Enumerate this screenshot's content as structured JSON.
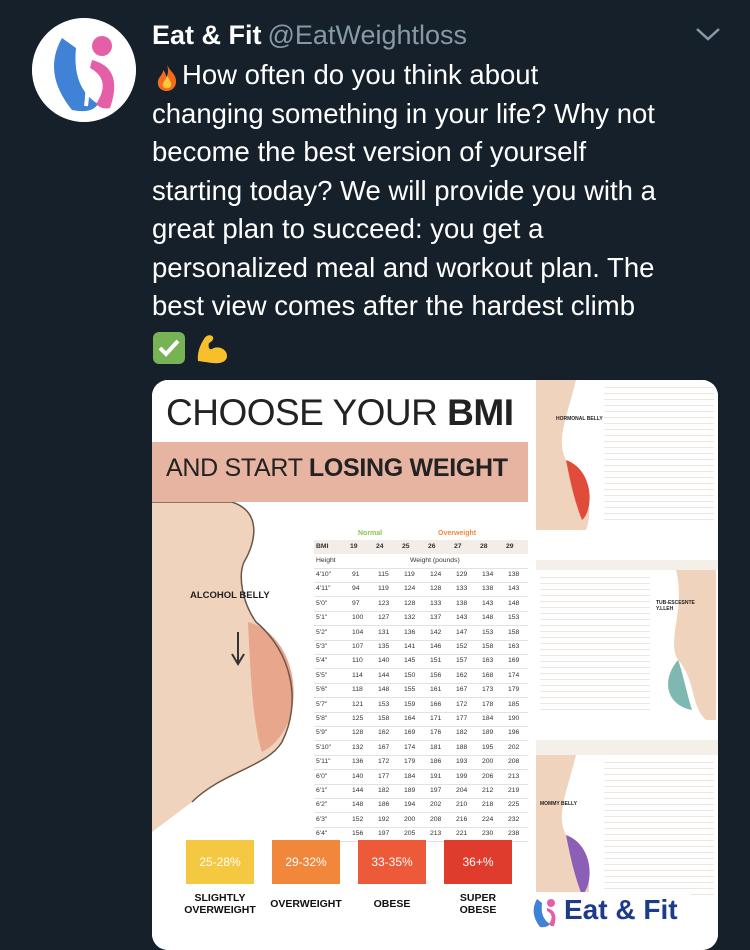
{
  "author": {
    "name": "Eat & Fit",
    "handle": "@EatWeightloss"
  },
  "tweet": {
    "lines": [
      "How often do you think about",
      "changing something in your life? Why not",
      "become the best version of yourself",
      "starting today? We will provide you with a",
      "great plan to succeed: you get a",
      "personalized meal and workout plan. The",
      "best view comes after the hardest climb"
    ]
  },
  "image": {
    "title_prefix": "CHOOSE YOUR ",
    "title_bold": "BMI",
    "subtitle_prefix": "AND START ",
    "subtitle_bold": "LOSING WEIGHT",
    "belly_label": "ALCOHOL BELLY",
    "table": {
      "normal_label": "Normal",
      "overweight_label": "Overweight",
      "bmi_label": "BMI",
      "bmi": [
        "19",
        "24",
        "25",
        "26",
        "27",
        "28",
        "29"
      ],
      "height_label": "Height",
      "weight_label": "Weight (pounds)",
      "rows": [
        [
          "4'10\"",
          "91",
          "115",
          "119",
          "124",
          "129",
          "134",
          "138"
        ],
        [
          "4'11\"",
          "94",
          "119",
          "124",
          "128",
          "133",
          "138",
          "143"
        ],
        [
          "5'0\"",
          "97",
          "123",
          "128",
          "133",
          "138",
          "143",
          "148"
        ],
        [
          "5'1\"",
          "100",
          "127",
          "132",
          "137",
          "143",
          "148",
          "153"
        ],
        [
          "5'2\"",
          "104",
          "131",
          "136",
          "142",
          "147",
          "153",
          "158"
        ],
        [
          "5'3\"",
          "107",
          "135",
          "141",
          "146",
          "152",
          "158",
          "163"
        ],
        [
          "5'4\"",
          "110",
          "140",
          "145",
          "151",
          "157",
          "163",
          "169"
        ],
        [
          "5'5\"",
          "114",
          "144",
          "150",
          "156",
          "162",
          "168",
          "174"
        ],
        [
          "5'6\"",
          "118",
          "148",
          "155",
          "161",
          "167",
          "173",
          "179"
        ],
        [
          "5'7\"",
          "121",
          "153",
          "159",
          "166",
          "172",
          "178",
          "185"
        ],
        [
          "5'8\"",
          "125",
          "158",
          "164",
          "171",
          "177",
          "184",
          "190"
        ],
        [
          "5'9\"",
          "128",
          "162",
          "169",
          "176",
          "182",
          "189",
          "196"
        ],
        [
          "5'10\"",
          "132",
          "167",
          "174",
          "181",
          "188",
          "195",
          "202"
        ],
        [
          "5'11\"",
          "136",
          "172",
          "179",
          "186",
          "193",
          "200",
          "208"
        ],
        [
          "6'0\"",
          "140",
          "177",
          "184",
          "191",
          "199",
          "206",
          "213"
        ],
        [
          "6'1\"",
          "144",
          "182",
          "189",
          "197",
          "204",
          "212",
          "219"
        ],
        [
          "6'2\"",
          "148",
          "186",
          "194",
          "202",
          "210",
          "218",
          "225"
        ],
        [
          "6'3\"",
          "152",
          "192",
          "200",
          "208",
          "216",
          "224",
          "232"
        ],
        [
          "6'4\"",
          "156",
          "197",
          "205",
          "213",
          "221",
          "230",
          "238"
        ]
      ]
    },
    "badges": [
      {
        "range": "25-28%",
        "label1": "SLIGHTLY",
        "label2": "OVERWEIGHT",
        "color": "#f5c842"
      },
      {
        "range": "29-32%",
        "label1": "",
        "label2": "OVERWEIGHT",
        "color": "#f0873a"
      },
      {
        "range": "33-35%",
        "label1": "",
        "label2": "OBESE",
        "color": "#ec5a3a"
      },
      {
        "range": "36+%",
        "label1": "SUPER",
        "label2": "OBESE",
        "color": "#e03c2e"
      }
    ],
    "side_labels": [
      "HORMONAL BELLY",
      "TUB-ESCESNTE Y.LLEH",
      "MOMMY BELLY"
    ],
    "logo_text": "Eat & Fit"
  }
}
